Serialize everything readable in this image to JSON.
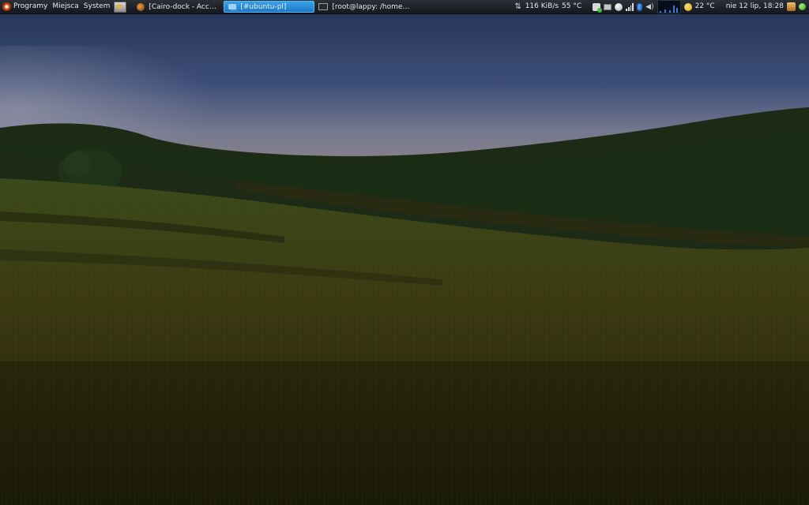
{
  "panel": {
    "menus": [
      {
        "label": "Programy",
        "icon": "ubuntu-logo-icon"
      },
      {
        "label": "Miejsca"
      },
      {
        "label": "System"
      }
    ],
    "launcher_icon": "screenshot-launcher-icon",
    "tasks": [
      {
        "label": "[Cairo-dock - Accueil - ...",
        "icon": "firefox-icon",
        "active": false
      },
      {
        "label": "[#ubuntu-pl]",
        "icon": "chat-icon",
        "active": true
      },
      {
        "label": "[root@lappy: /home/dhor]",
        "icon": "terminal-icon",
        "active": false
      }
    ],
    "tray": {
      "network_speed": "116 KiB/s",
      "cpu_temperature": "55 °C",
      "weather_temperature": "22 °C",
      "clock": "nie 12 lip, 18:28"
    }
  },
  "colors": {
    "panel_bg": "#1d2127",
    "active_task": "#2a8fd8",
    "sky": "#31426a",
    "grass": "#3a3a12"
  }
}
